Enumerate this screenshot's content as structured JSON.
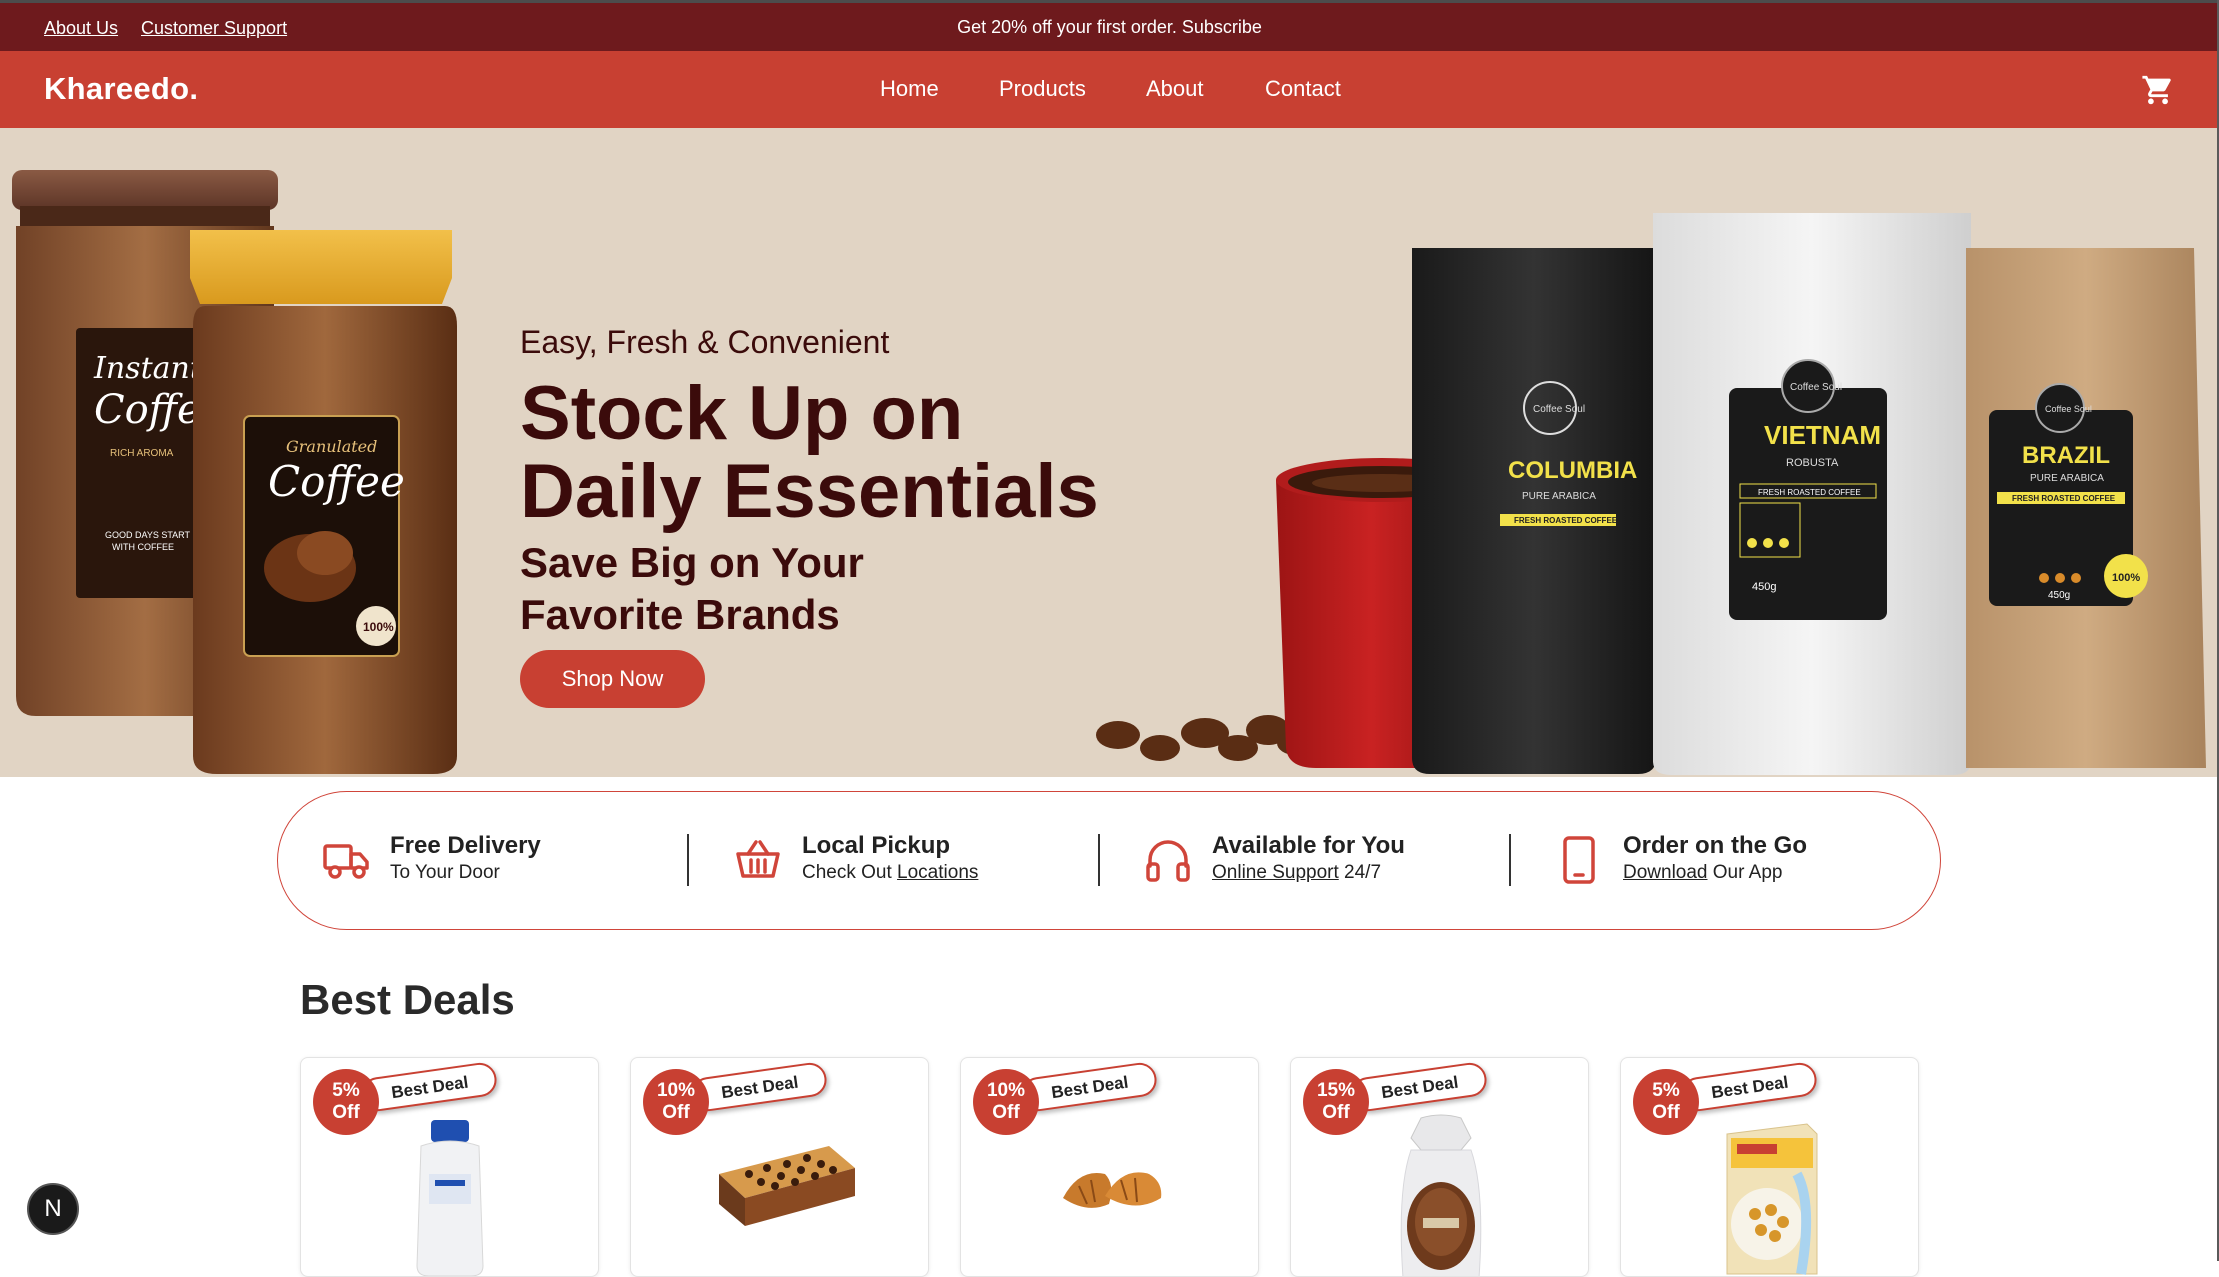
{
  "topbar": {
    "about_link": "About Us",
    "support_link": "Customer Support",
    "promo": "Get 20% off your first order. Subscribe"
  },
  "nav": {
    "brand": "Khareedo.",
    "links": [
      "Home",
      "Products",
      "About",
      "Contact"
    ],
    "cart_icon": "cart-icon"
  },
  "hero": {
    "eyebrow": "Easy, Fresh & Convenient",
    "headline_line1": "Stock Up on",
    "headline_line2": "Daily Essentials",
    "subline_line1": "Save Big on Your",
    "subline_line2": "Favorite Brands",
    "cta": "Shop Now",
    "jar1_label": [
      "Instant",
      "Coffee",
      "RICH AROMA",
      "GOOD DAYS START",
      "WITH COFFEE"
    ],
    "jar2_label": [
      "Granulated",
      "Coffee",
      "100%"
    ],
    "bags": [
      {
        "origin": "COLUMBIA",
        "type": "PURE ARABICA",
        "strip": "FRESH ROASTED COFFEE",
        "brand": "Coffee Soul"
      },
      {
        "origin": "VIETNAM",
        "type": "ROBUSTA",
        "strip": "FRESH ROASTED COFFEE",
        "brand": "Coffee Soul",
        "weight": "450g"
      },
      {
        "origin": "BRAZIL",
        "type": "PURE ARABICA",
        "strip": "FRESH ROASTED COFFEE",
        "brand": "Coffee Soul",
        "weight": "450g",
        "seal": "100%"
      }
    ]
  },
  "features": [
    {
      "icon": "truck-icon",
      "title": "Free Delivery",
      "sub_pre": "To Your Door",
      "sub_link": "",
      "sub_post": ""
    },
    {
      "icon": "basket-icon",
      "title": "Local Pickup",
      "sub_pre": "Check Out ",
      "sub_link": "Locations",
      "sub_post": ""
    },
    {
      "icon": "headphones-icon",
      "title": "Available for You",
      "sub_pre": "",
      "sub_link": "Online Support",
      "sub_post": " 24/7"
    },
    {
      "icon": "phone-icon",
      "title": "Order on the Go",
      "sub_pre": "",
      "sub_link": "Download",
      "sub_post": " Our App"
    }
  ],
  "deals": {
    "title": "Best Deals",
    "ribbon": "Best Deal",
    "items": [
      {
        "pct": "5%",
        "off": "Off",
        "product": "lotion-bottle"
      },
      {
        "pct": "10%",
        "off": "Off",
        "product": "cake"
      },
      {
        "pct": "10%",
        "off": "Off",
        "product": "croissants"
      },
      {
        "pct": "15%",
        "off": "Off",
        "product": "bread-loaf"
      },
      {
        "pct": "5%",
        "off": "Off",
        "product": "cereal-box"
      }
    ]
  },
  "floating": {
    "label": "N"
  },
  "colors": {
    "primary": "#c84032",
    "dark": "#6e1a1d",
    "hero_bg": "#e1d4c4",
    "headline": "#3b0b0b"
  }
}
